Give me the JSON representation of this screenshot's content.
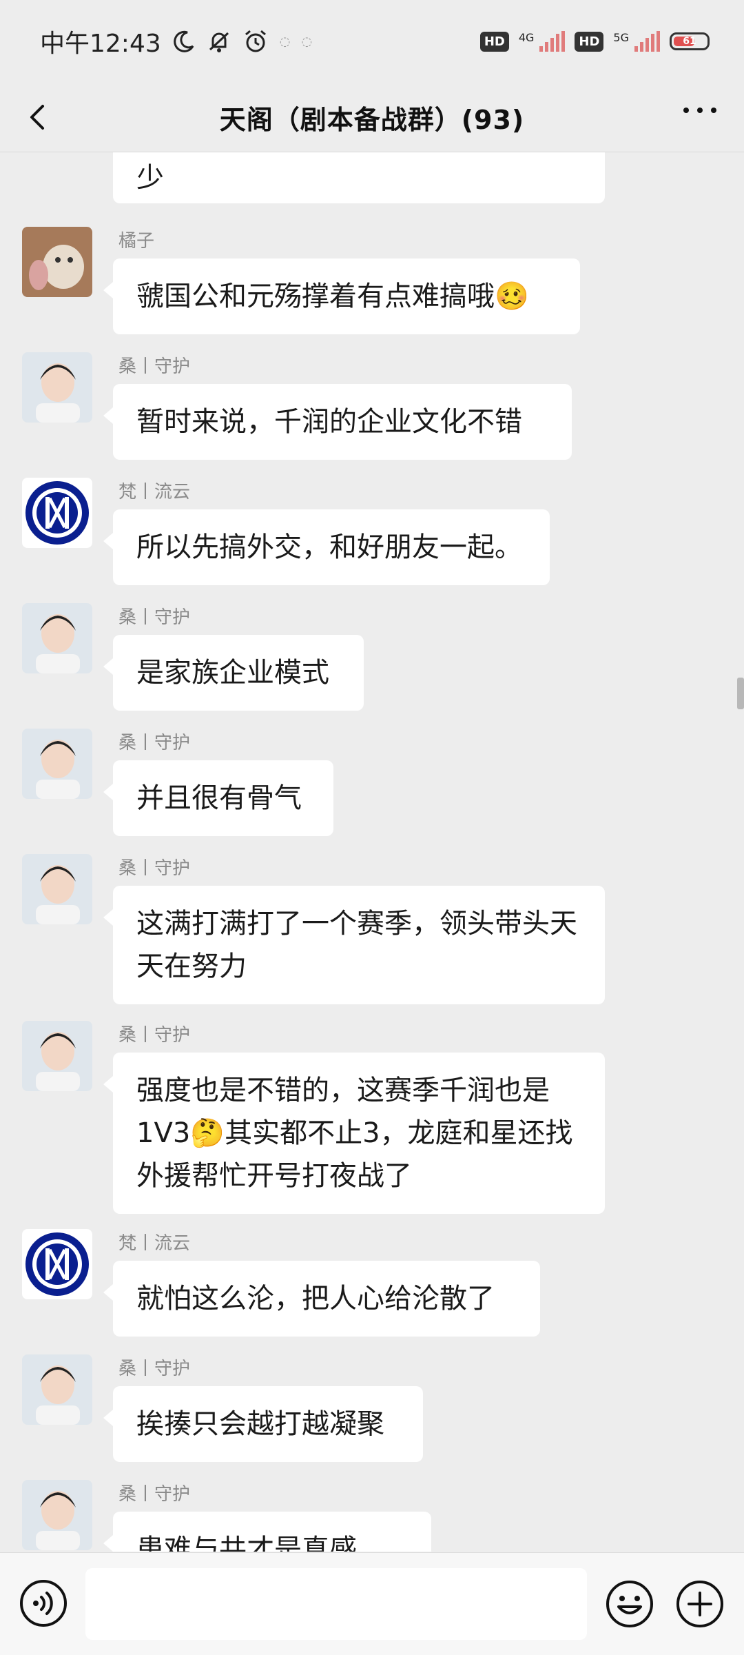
{
  "status_bar": {
    "time": "中午12:43",
    "icons": [
      "moon-icon",
      "mute-bell-icon",
      "alarm-icon"
    ],
    "hd1": "HD",
    "net1": "4G",
    "hd2": "HD",
    "net2": "5G",
    "battery": "61"
  },
  "header": {
    "title": "天阁（剧本备战群）(93)",
    "back_icon": "back-arrow-icon",
    "more_icon": "more-dots-icon"
  },
  "messages": [
    {
      "sender": "",
      "text": "少",
      "avatar": "none"
    },
    {
      "sender": "橘子",
      "text": "虢国公和元殇撑着有点难搞哦🥴",
      "avatar": "cat-photo"
    },
    {
      "sender": "桑丨守护",
      "text": "暂时来说，千润的企业文化不错",
      "avatar": "person-photo"
    },
    {
      "sender": "梵丨流云",
      "text": "所以先搞外交，和好朋友一起。",
      "avatar": "inter-logo"
    },
    {
      "sender": "桑丨守护",
      "text": "是家族企业模式",
      "avatar": "person-photo"
    },
    {
      "sender": "桑丨守护",
      "text": "并且很有骨气",
      "avatar": "person-photo"
    },
    {
      "sender": "桑丨守护",
      "text": "这满打满打了一个赛季，领头带头天天在努力",
      "avatar": "person-photo"
    },
    {
      "sender": "桑丨守护",
      "text": "强度也是不错的，这赛季千润也是1V3🤔其实都不止3，龙庭和星还找外援帮忙开号打夜战了",
      "avatar": "person-photo"
    },
    {
      "sender": "梵丨流云",
      "text": "就怕这么沦，把人心给沦散了",
      "avatar": "inter-logo"
    },
    {
      "sender": "桑丨守护",
      "text": "挨揍只会越打越凝聚",
      "avatar": "person-photo"
    },
    {
      "sender": "桑丨守护",
      "text": "患难与共才是真感情。",
      "avatar": "person-photo"
    }
  ],
  "input_bar": {
    "voice_icon": "voice-icon",
    "emoji_icon": "emoji-icon",
    "plus_icon": "plus-icon",
    "placeholder": ""
  },
  "colors": {
    "background": "#ededed",
    "bubble": "#ffffff",
    "inter_blue": "#0a1f8f"
  }
}
